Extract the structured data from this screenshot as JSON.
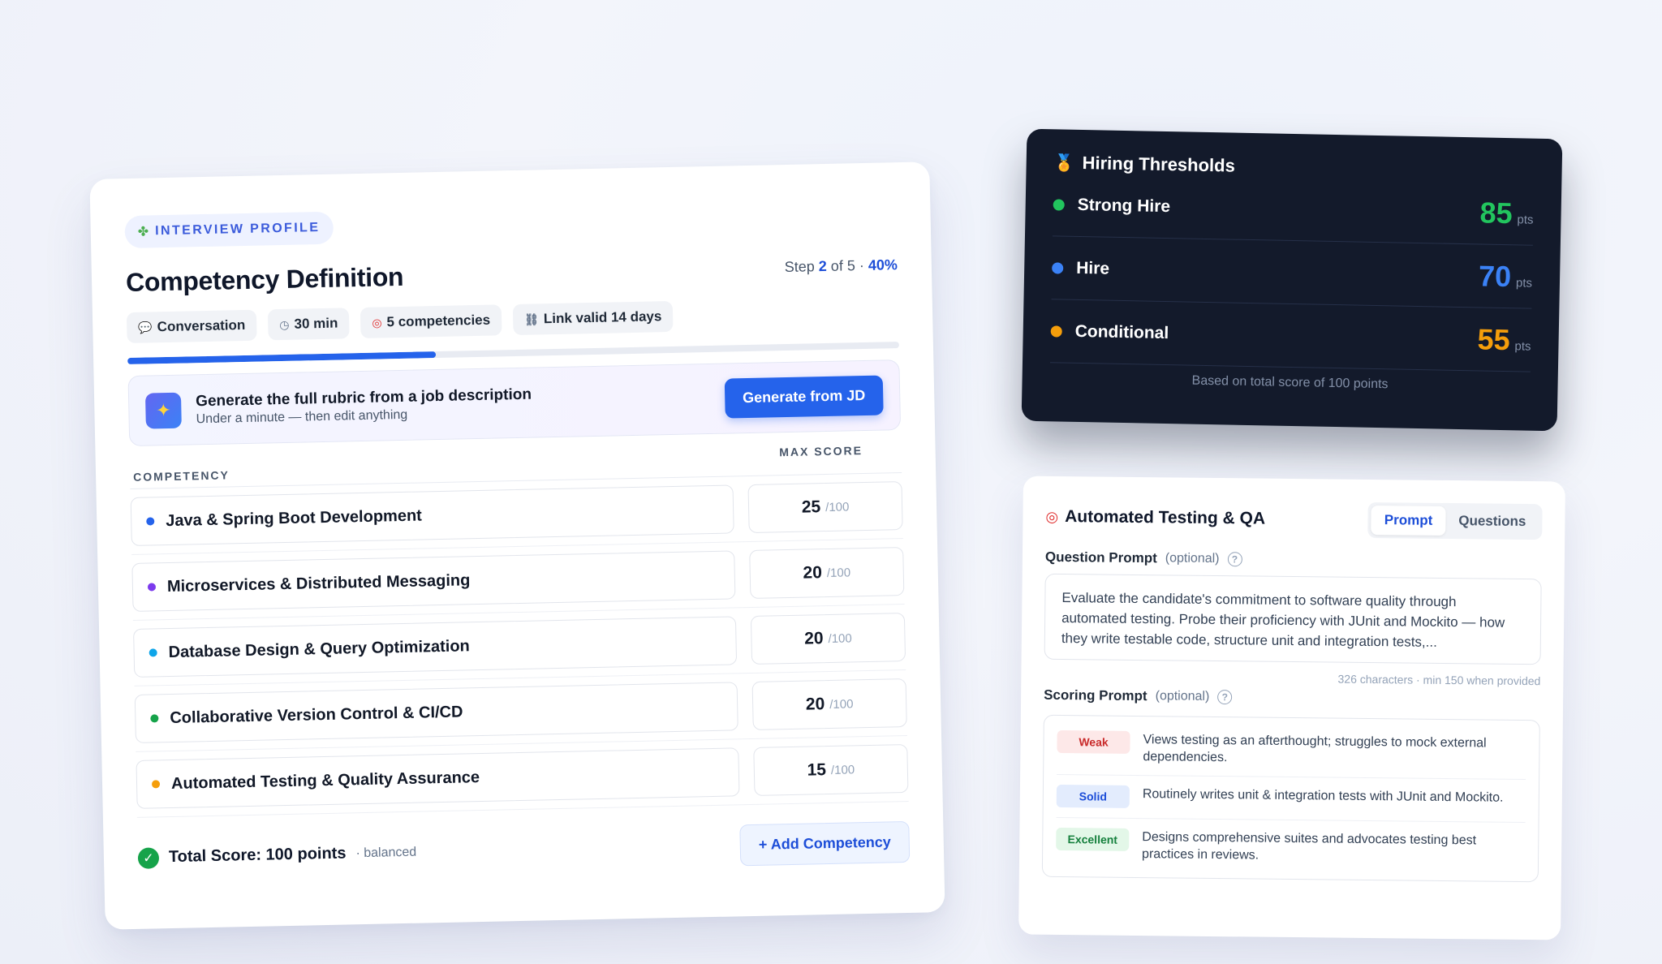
{
  "profile": {
    "pill_label": "INTERVIEW PROFILE",
    "title": "Competency Definition",
    "step_prefix": "Step ",
    "step_current": "2",
    "step_suffix": " of 5 · ",
    "step_percent": "40%",
    "progress_fraction": 0.4,
    "chips": [
      {
        "icon": "chat-icon",
        "label": "Conversation"
      },
      {
        "icon": "clock-icon",
        "label": "30 min"
      },
      {
        "icon": "target-icon",
        "label": "5 competencies"
      },
      {
        "icon": "link-icon",
        "label": "Link valid 14 days"
      }
    ]
  },
  "generate": {
    "title": "Generate the full rubric from a job description",
    "subtitle": "Under a minute — then edit anything",
    "button": "Generate from JD"
  },
  "table": {
    "col_competency": "COMPETENCY",
    "col_max_score": "MAX SCORE",
    "denominator": "/100",
    "rows": [
      {
        "name": "Java & Spring Boot Development",
        "score": "25",
        "color": "#2563eb"
      },
      {
        "name": "Microservices & Distributed Messaging",
        "score": "20",
        "color": "#7c3aed"
      },
      {
        "name": "Database Design & Query Optimization",
        "score": "20",
        "color": "#0ea5e9"
      },
      {
        "name": "Collaborative Version Control & CI/CD",
        "score": "20",
        "color": "#16a34a"
      },
      {
        "name": "Automated Testing & Quality Assurance",
        "score": "15",
        "color": "#f59e0b"
      }
    ]
  },
  "footer": {
    "total": "Total Score: 100 points",
    "note": "· balanced",
    "add_button": "+ Add Competency"
  },
  "thresholds": {
    "title": "Hiring Thresholds",
    "unit": "pts",
    "rows": [
      {
        "label": "Strong Hire",
        "value": "85",
        "color": "#22c55e"
      },
      {
        "label": "Hire",
        "value": "70",
        "color": "#3b82f6"
      },
      {
        "label": "Conditional",
        "value": "55",
        "color": "#f59e0b"
      }
    ],
    "footnote": "Based on total score of 100 points"
  },
  "qa": {
    "title": "Automated Testing & QA",
    "tabs": [
      "Prompt",
      "Questions"
    ],
    "active_tab": "Prompt",
    "question_label": "Question Prompt",
    "optional": "(optional)",
    "question_text": "Evaluate the candidate's commitment to software quality through automated testing. Probe their proficiency with JUnit and Mockito — how they write testable code, structure unit and integration tests,...",
    "char_count": "326 characters · min 150 when provided",
    "scoring_label": "Scoring Prompt",
    "rubric": [
      {
        "level": "Weak",
        "text": "Views testing as an afterthought; struggles to mock external dependencies.",
        "bg": "#fde8e8",
        "fg": "#c92a2a"
      },
      {
        "level": "Solid",
        "text": "Routinely writes unit & integration tests with JUnit and Mockito.",
        "bg": "#e3ecfd",
        "fg": "#1d4ed8"
      },
      {
        "level": "Excellent",
        "text": "Designs comprehensive suites and advocates testing best practices in reviews.",
        "bg": "#e3f7e8",
        "fg": "#15803d"
      }
    ]
  }
}
